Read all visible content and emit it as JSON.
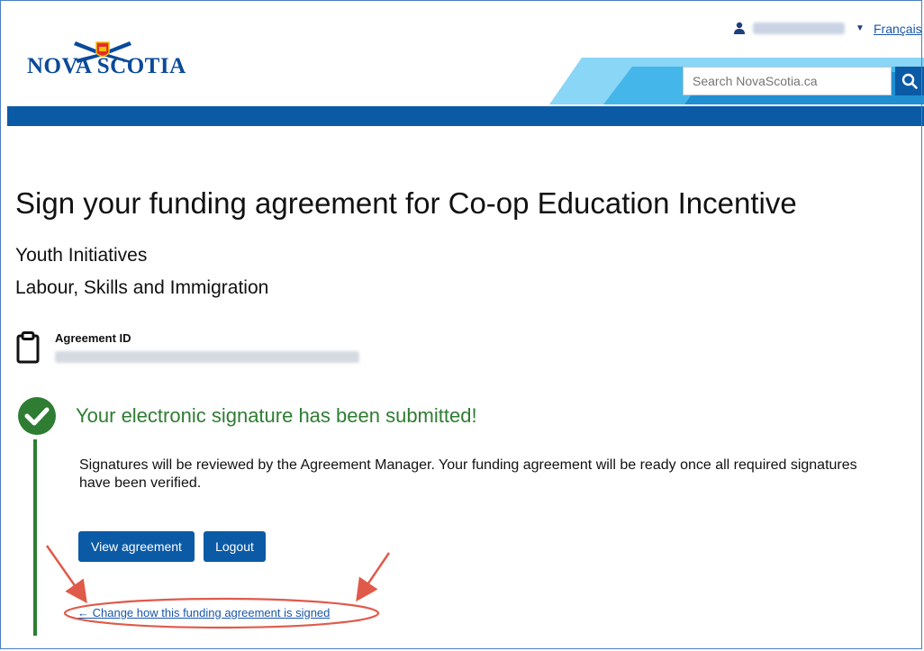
{
  "header": {
    "logo_text": "NOVA SCOTIA",
    "user_name": "",
    "language_link": "Français",
    "search": {
      "placeholder": "Search NovaScotia.ca"
    }
  },
  "main": {
    "title": "Sign your funding agreement for Co-op Education Incentive",
    "program": "Youth Initiatives",
    "department": "Labour, Skills and Immigration",
    "agreement": {
      "label": "Agreement ID",
      "value": ""
    },
    "status": {
      "title": "Your electronic signature has been submitted!",
      "message": "Signatures will be reviewed by the Agreement Manager. Your funding agreement will be ready once all required signatures have been verified."
    },
    "buttons": {
      "view_agreement": "View agreement",
      "logout": "Logout"
    },
    "change_link": "← Change how this funding agreement is signed"
  },
  "icons": {
    "user": "user-icon",
    "search": "search-icon",
    "clipboard": "clipboard-icon",
    "success": "check-circle-icon"
  },
  "colors": {
    "primary_blue": "#0b5aa6",
    "success_green": "#2e7d32",
    "link_blue": "#1b56a8",
    "annotation_red": "#e05a4a"
  }
}
